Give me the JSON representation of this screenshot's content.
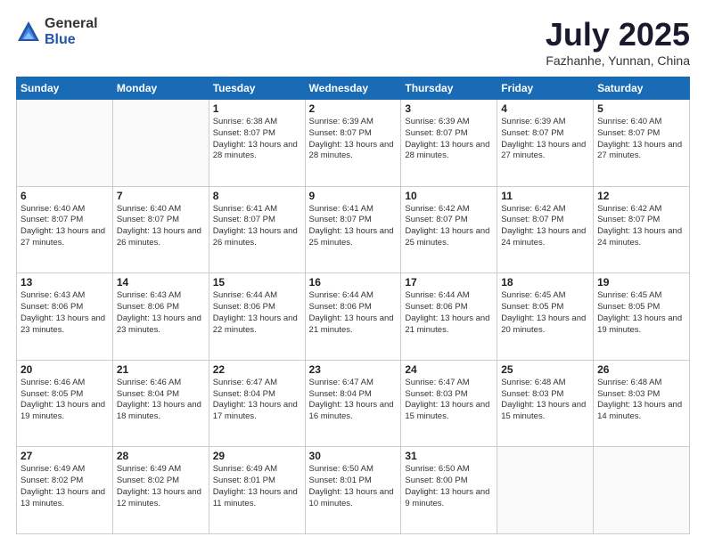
{
  "logo": {
    "general": "General",
    "blue": "Blue"
  },
  "header": {
    "month": "July 2025",
    "location": "Fazhanhe, Yunnan, China"
  },
  "weekdays": [
    "Sunday",
    "Monday",
    "Tuesday",
    "Wednesday",
    "Thursday",
    "Friday",
    "Saturday"
  ],
  "weeks": [
    [
      {
        "day": "",
        "text": ""
      },
      {
        "day": "",
        "text": ""
      },
      {
        "day": "1",
        "text": "Sunrise: 6:38 AM\nSunset: 8:07 PM\nDaylight: 13 hours and 28 minutes."
      },
      {
        "day": "2",
        "text": "Sunrise: 6:39 AM\nSunset: 8:07 PM\nDaylight: 13 hours and 28 minutes."
      },
      {
        "day": "3",
        "text": "Sunrise: 6:39 AM\nSunset: 8:07 PM\nDaylight: 13 hours and 28 minutes."
      },
      {
        "day": "4",
        "text": "Sunrise: 6:39 AM\nSunset: 8:07 PM\nDaylight: 13 hours and 27 minutes."
      },
      {
        "day": "5",
        "text": "Sunrise: 6:40 AM\nSunset: 8:07 PM\nDaylight: 13 hours and 27 minutes."
      }
    ],
    [
      {
        "day": "6",
        "text": "Sunrise: 6:40 AM\nSunset: 8:07 PM\nDaylight: 13 hours and 27 minutes."
      },
      {
        "day": "7",
        "text": "Sunrise: 6:40 AM\nSunset: 8:07 PM\nDaylight: 13 hours and 26 minutes."
      },
      {
        "day": "8",
        "text": "Sunrise: 6:41 AM\nSunset: 8:07 PM\nDaylight: 13 hours and 26 minutes."
      },
      {
        "day": "9",
        "text": "Sunrise: 6:41 AM\nSunset: 8:07 PM\nDaylight: 13 hours and 25 minutes."
      },
      {
        "day": "10",
        "text": "Sunrise: 6:42 AM\nSunset: 8:07 PM\nDaylight: 13 hours and 25 minutes."
      },
      {
        "day": "11",
        "text": "Sunrise: 6:42 AM\nSunset: 8:07 PM\nDaylight: 13 hours and 24 minutes."
      },
      {
        "day": "12",
        "text": "Sunrise: 6:42 AM\nSunset: 8:07 PM\nDaylight: 13 hours and 24 minutes."
      }
    ],
    [
      {
        "day": "13",
        "text": "Sunrise: 6:43 AM\nSunset: 8:06 PM\nDaylight: 13 hours and 23 minutes."
      },
      {
        "day": "14",
        "text": "Sunrise: 6:43 AM\nSunset: 8:06 PM\nDaylight: 13 hours and 23 minutes."
      },
      {
        "day": "15",
        "text": "Sunrise: 6:44 AM\nSunset: 8:06 PM\nDaylight: 13 hours and 22 minutes."
      },
      {
        "day": "16",
        "text": "Sunrise: 6:44 AM\nSunset: 8:06 PM\nDaylight: 13 hours and 21 minutes."
      },
      {
        "day": "17",
        "text": "Sunrise: 6:44 AM\nSunset: 8:06 PM\nDaylight: 13 hours and 21 minutes."
      },
      {
        "day": "18",
        "text": "Sunrise: 6:45 AM\nSunset: 8:05 PM\nDaylight: 13 hours and 20 minutes."
      },
      {
        "day": "19",
        "text": "Sunrise: 6:45 AM\nSunset: 8:05 PM\nDaylight: 13 hours and 19 minutes."
      }
    ],
    [
      {
        "day": "20",
        "text": "Sunrise: 6:46 AM\nSunset: 8:05 PM\nDaylight: 13 hours and 19 minutes."
      },
      {
        "day": "21",
        "text": "Sunrise: 6:46 AM\nSunset: 8:04 PM\nDaylight: 13 hours and 18 minutes."
      },
      {
        "day": "22",
        "text": "Sunrise: 6:47 AM\nSunset: 8:04 PM\nDaylight: 13 hours and 17 minutes."
      },
      {
        "day": "23",
        "text": "Sunrise: 6:47 AM\nSunset: 8:04 PM\nDaylight: 13 hours and 16 minutes."
      },
      {
        "day": "24",
        "text": "Sunrise: 6:47 AM\nSunset: 8:03 PM\nDaylight: 13 hours and 15 minutes."
      },
      {
        "day": "25",
        "text": "Sunrise: 6:48 AM\nSunset: 8:03 PM\nDaylight: 13 hours and 15 minutes."
      },
      {
        "day": "26",
        "text": "Sunrise: 6:48 AM\nSunset: 8:03 PM\nDaylight: 13 hours and 14 minutes."
      }
    ],
    [
      {
        "day": "27",
        "text": "Sunrise: 6:49 AM\nSunset: 8:02 PM\nDaylight: 13 hours and 13 minutes."
      },
      {
        "day": "28",
        "text": "Sunrise: 6:49 AM\nSunset: 8:02 PM\nDaylight: 13 hours and 12 minutes."
      },
      {
        "day": "29",
        "text": "Sunrise: 6:49 AM\nSunset: 8:01 PM\nDaylight: 13 hours and 11 minutes."
      },
      {
        "day": "30",
        "text": "Sunrise: 6:50 AM\nSunset: 8:01 PM\nDaylight: 13 hours and 10 minutes."
      },
      {
        "day": "31",
        "text": "Sunrise: 6:50 AM\nSunset: 8:00 PM\nDaylight: 13 hours and 9 minutes."
      },
      {
        "day": "",
        "text": ""
      },
      {
        "day": "",
        "text": ""
      }
    ]
  ]
}
